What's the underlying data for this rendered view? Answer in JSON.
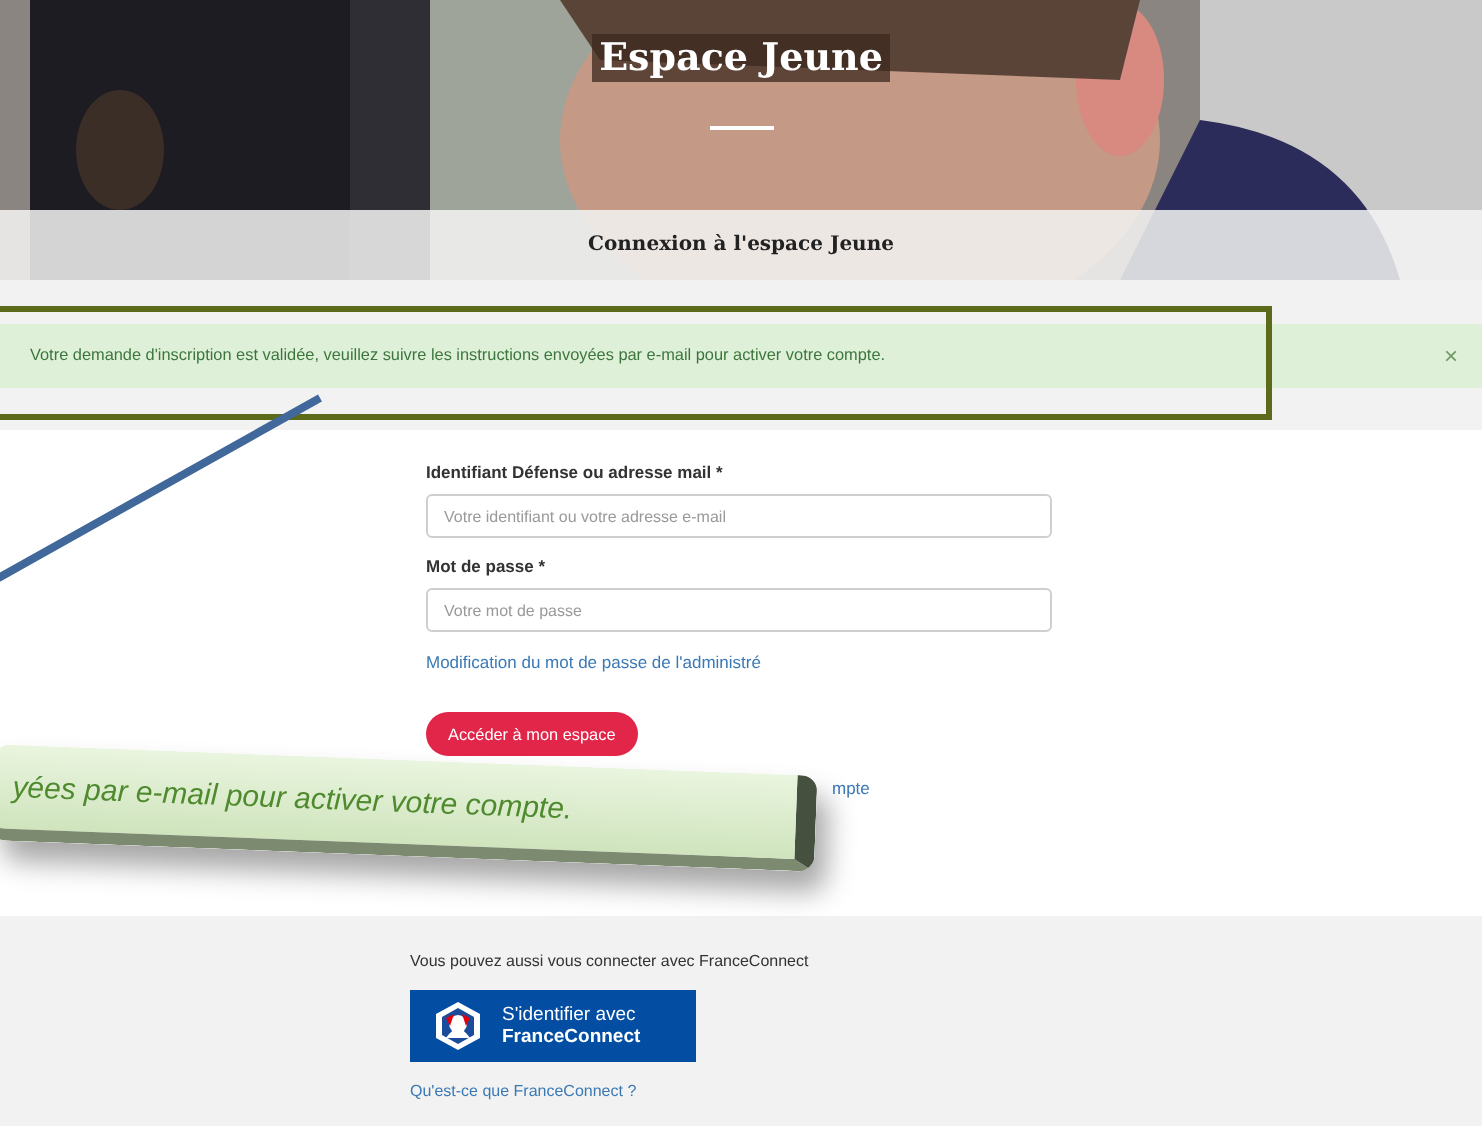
{
  "hero": {
    "title": "Espace Jeune"
  },
  "heading": "Connexion à l'espace Jeune",
  "alert": {
    "message": "Votre demande d'inscription est validée, veuillez suivre les instructions envoyées par e-mail pour activer votre compte.",
    "close": "×"
  },
  "form": {
    "fields": [
      {
        "label": "Identifiant Défense ou adresse mail *",
        "placeholder": "Votre identifiant ou votre adresse e-mail"
      },
      {
        "label": "Mot de passe *",
        "placeholder": "Votre mot de passe"
      }
    ],
    "reset_link": "Modification du mot de passe de l'administré",
    "submit": "Accéder à mon espace",
    "covered_link": "mpte"
  },
  "franceconnect": {
    "intro": "Vous pouvez aussi vous connecter avec FranceConnect",
    "button_lines": [
      "S'identifier avec",
      "FranceConnect"
    ],
    "help_link": "Qu'est-ce que FranceConnect ?"
  },
  "callout": {
    "text": "yées par e-mail pour activer votre compte."
  }
}
